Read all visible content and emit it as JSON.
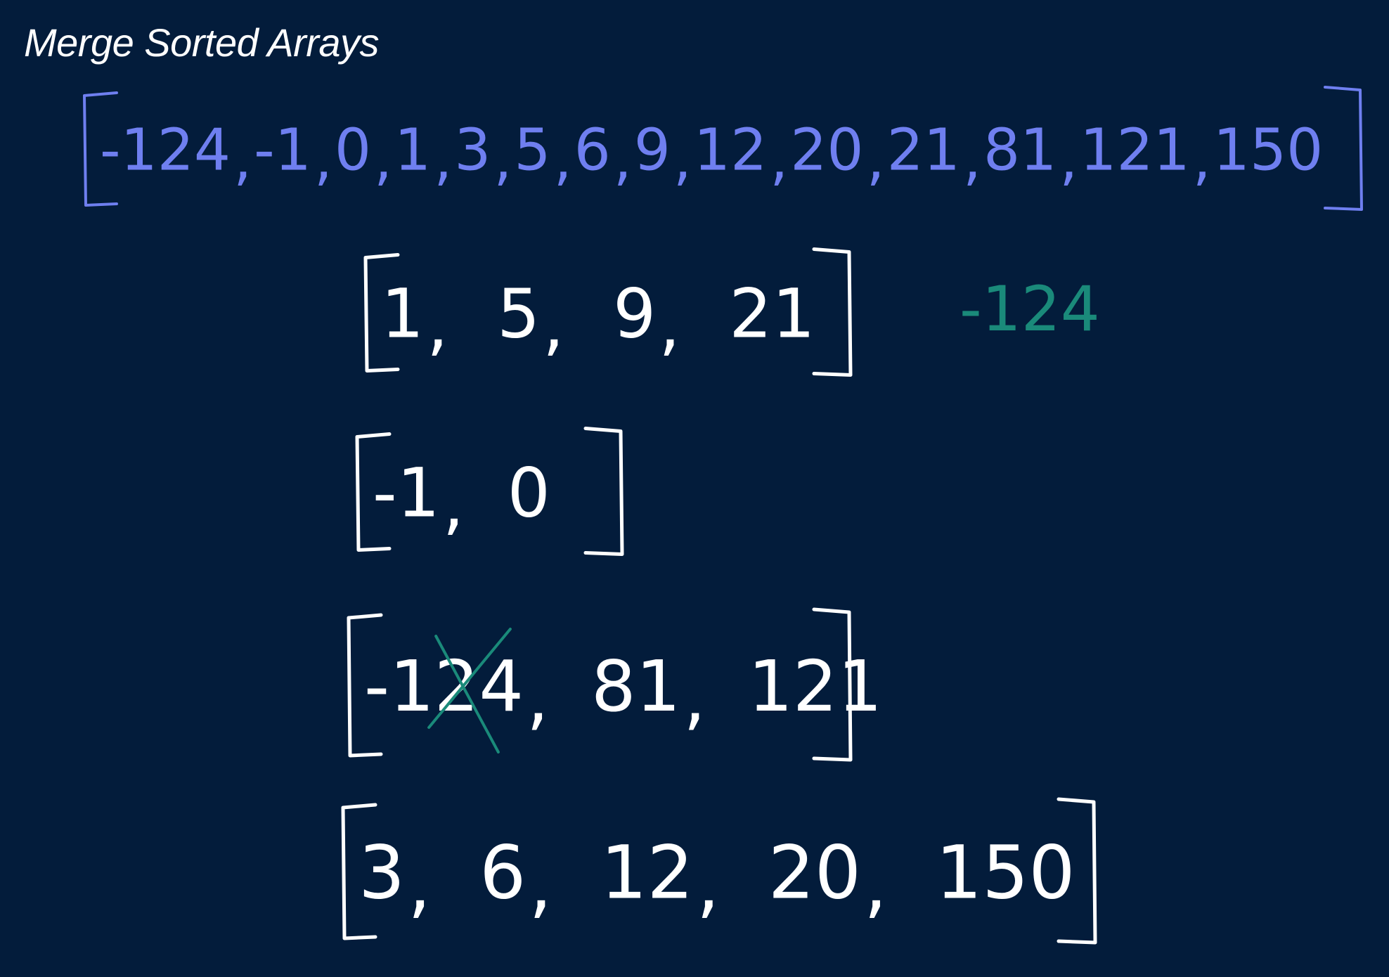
{
  "title": "Merge Sorted Arrays",
  "colors": {
    "background": "#031c3b",
    "merged_ink": "#6f7ff0",
    "array_ink": "#ffffff",
    "annotation_ink": "#1a8a7a"
  },
  "merged": {
    "values": [
      "-124",
      "-1",
      "0",
      "1",
      "3",
      "5",
      "6",
      "9",
      "12",
      "20",
      "21",
      "81",
      "121",
      "150"
    ]
  },
  "arrays": [
    {
      "values": [
        "1",
        "5",
        "9",
        "21"
      ]
    },
    {
      "values": [
        "-1",
        "0"
      ]
    },
    {
      "values": [
        "-124",
        "81",
        "121"
      ]
    },
    {
      "values": [
        "3",
        "6",
        "12",
        "20",
        "150"
      ]
    }
  ],
  "annotation": {
    "text": "-124"
  },
  "crossed_out": {
    "array_index": 2,
    "value_index": 0
  }
}
